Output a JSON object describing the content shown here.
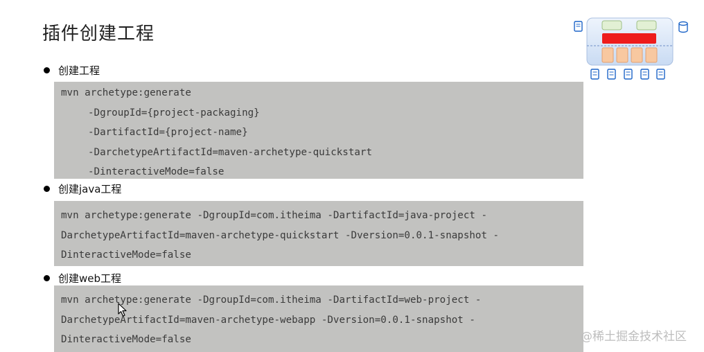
{
  "slide": {
    "title": "插件创建工程"
  },
  "sections": [
    {
      "heading": "创建工程",
      "lines": [
        "mvn archetype:generate",
        "-DgroupId={project-packaging}",
        "-DartifactId={project-name}",
        "-DarchetypeArtifactId=maven-archetype-quickstart",
        "-DinteractiveMode=false"
      ]
    },
    {
      "heading": "创建java工程",
      "lines": [
        "mvn archetype:generate -DgroupId=com.itheima -DartifactId=java-project -",
        "DarchetypeArtifactId=maven-archetype-quickstart -Dversion=0.0.1-snapshot -",
        "DinteractiveMode=false"
      ]
    },
    {
      "heading": "创建web工程",
      "lines": [
        "mvn archetype:generate -DgroupId=com.itheima -DartifactId=web-project -",
        "DarchetypeArtifactId=maven-archetype-webapp -Dversion=0.0.1-snapshot -",
        "DinteractiveMode=false"
      ]
    }
  ],
  "watermark": "@稀土掘金技术社区",
  "colors": {
    "code_background": "#c2c2c0",
    "diagram_red": "#ee1c1c",
    "diagram_orange": "#f8c8a0",
    "diagram_green": "#e2f0d4",
    "diagram_blue": "#1c64c8"
  }
}
